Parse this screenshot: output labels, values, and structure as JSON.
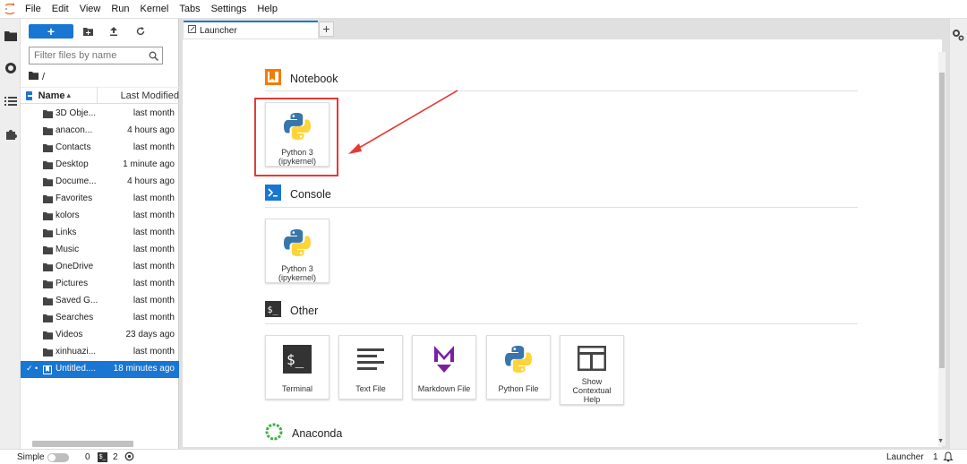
{
  "menu": [
    "File",
    "Edit",
    "View",
    "Run",
    "Kernel",
    "Tabs",
    "Settings",
    "Help"
  ],
  "filebrowser": {
    "new_label": "+",
    "filter_placeholder": "Filter files by name",
    "breadcrumb": "/",
    "col_name": "Name",
    "col_modified": "Last Modified",
    "files": [
      {
        "name": "3D Obje...",
        "modified": "last month"
      },
      {
        "name": "anacon...",
        "modified": "4 hours ago"
      },
      {
        "name": "Contacts",
        "modified": "last month"
      },
      {
        "name": "Desktop",
        "modified": "1 minute ago"
      },
      {
        "name": "Docume...",
        "modified": "4 hours ago"
      },
      {
        "name": "Favorites",
        "modified": "last month"
      },
      {
        "name": "kolors",
        "modified": "last month"
      },
      {
        "name": "Links",
        "modified": "last month"
      },
      {
        "name": "Music",
        "modified": "last month"
      },
      {
        "name": "OneDrive",
        "modified": "last month"
      },
      {
        "name": "Pictures",
        "modified": "last month"
      },
      {
        "name": "Saved G...",
        "modified": "last month"
      },
      {
        "name": "Searches",
        "modified": "last month"
      },
      {
        "name": "Videos",
        "modified": "23 days ago"
      },
      {
        "name": "xinhuazi...",
        "modified": "last month"
      },
      {
        "name": "Untitled....",
        "modified": "18 minutes ago"
      }
    ]
  },
  "tabs": {
    "launcher_label": "Launcher",
    "add_label": "+"
  },
  "launcher": {
    "notebook_title": "Notebook",
    "console_title": "Console",
    "other_title": "Other",
    "anaconda_title": "Anaconda",
    "notebook_card": {
      "line1": "Python 3",
      "line2": "(ipykernel)"
    },
    "console_card": {
      "line1": "Python 3",
      "line2": "(ipykernel)"
    },
    "other_cards": [
      {
        "line1": "Terminal"
      },
      {
        "line1": "Text File"
      },
      {
        "line1": "Markdown File"
      },
      {
        "line1": "Python File"
      },
      {
        "line1": "Show",
        "line2": "Contextual",
        "line3": "Help"
      }
    ]
  },
  "status": {
    "mode": "Simple",
    "count_a": "0",
    "count_b": "2",
    "active": "Launcher",
    "notif_count": "1"
  },
  "colors": {
    "accent": "#1976d2",
    "highlight": "#e53935",
    "notebook_orange": "#f57c00"
  }
}
